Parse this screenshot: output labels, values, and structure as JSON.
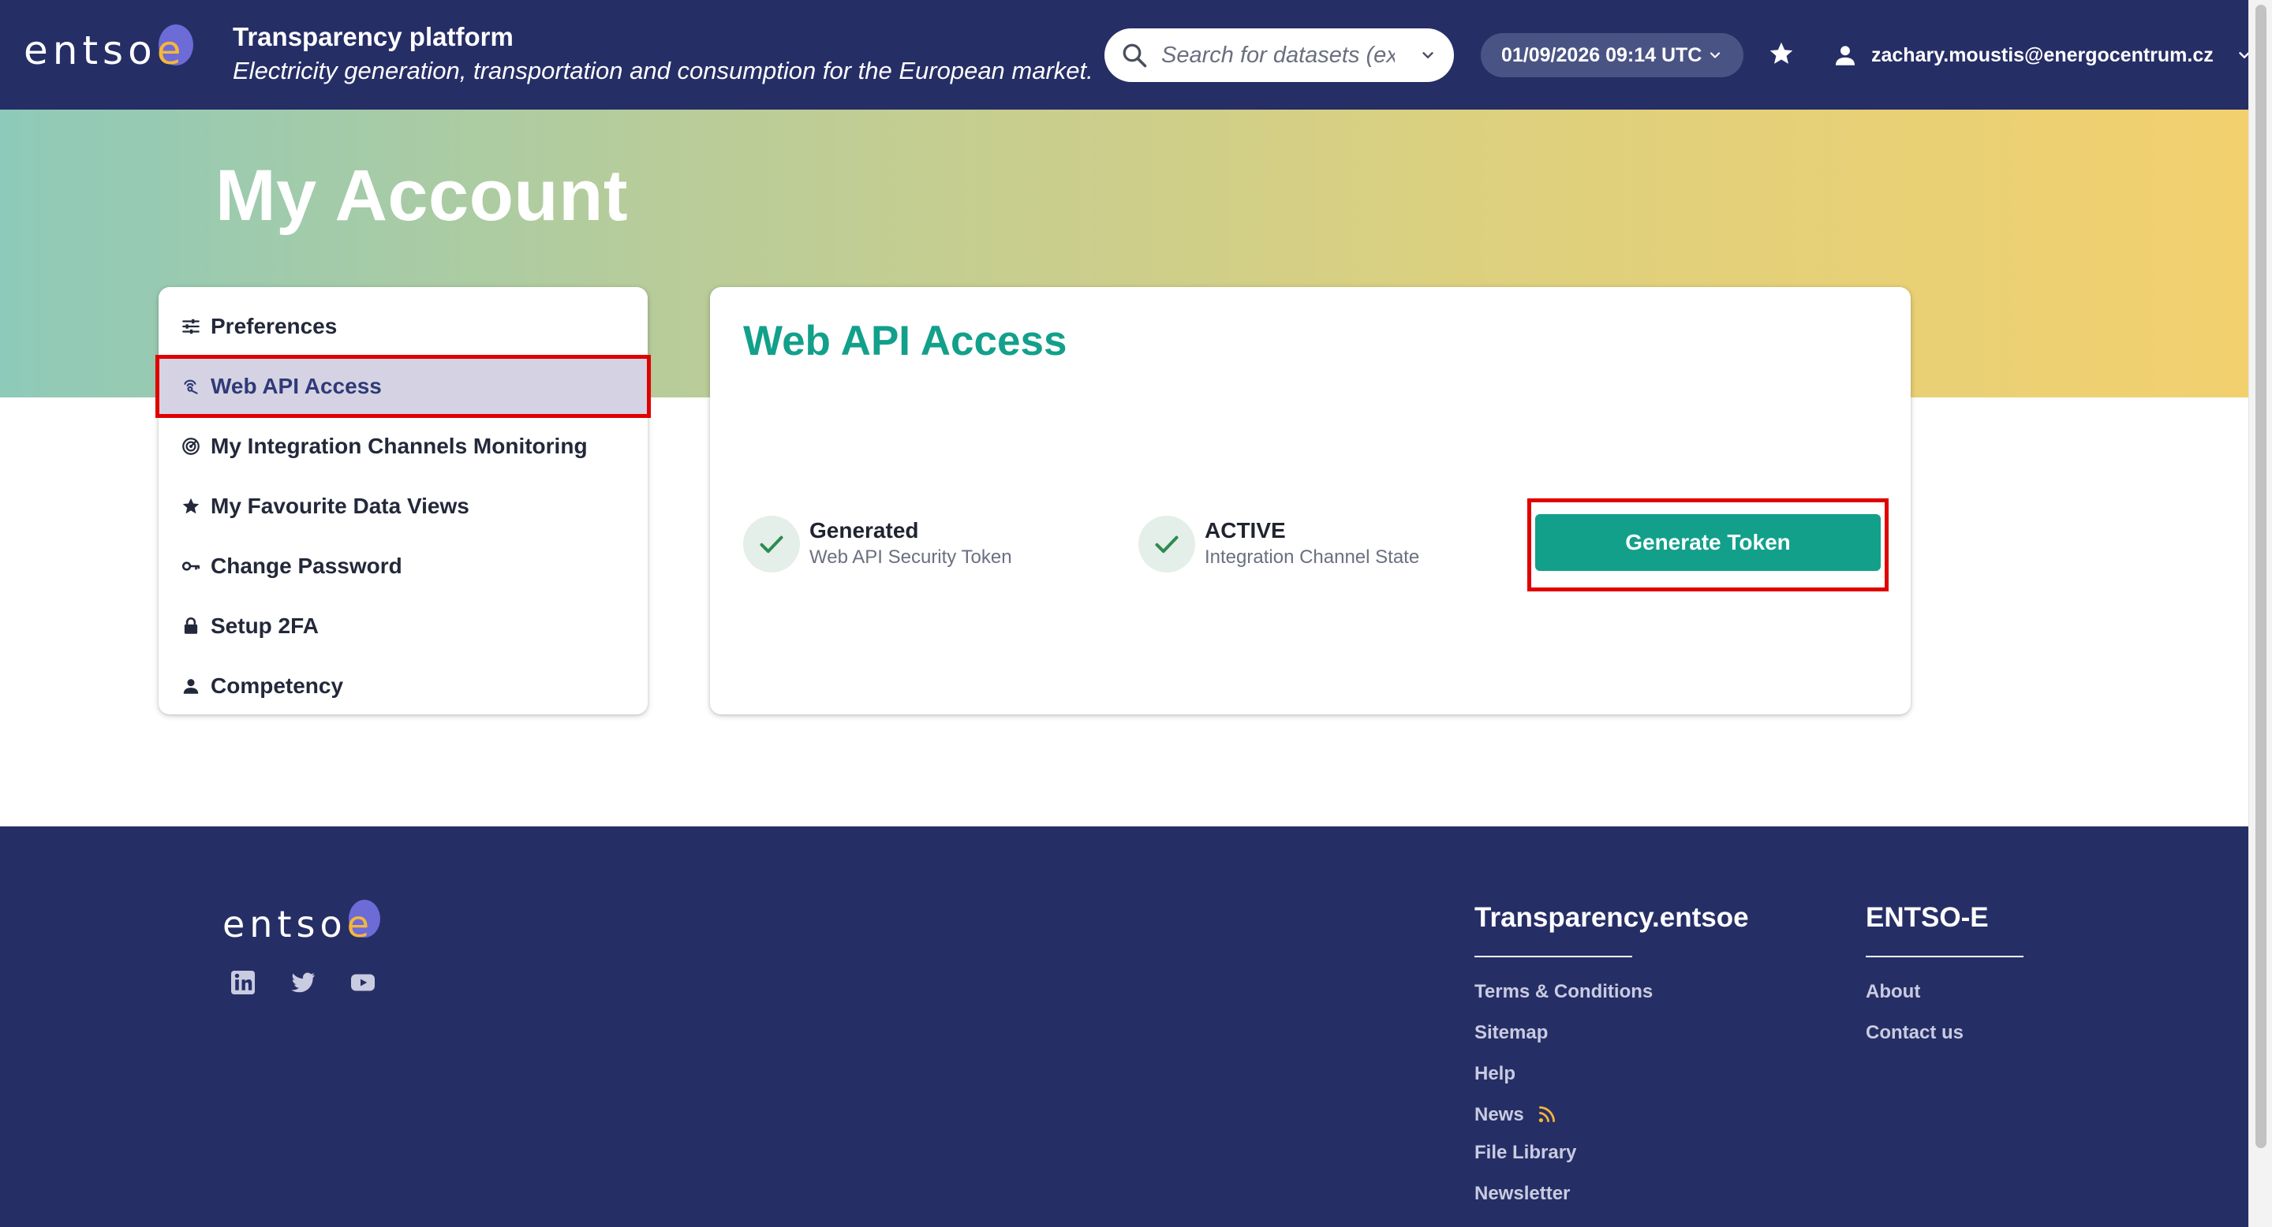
{
  "header": {
    "logo_text": "entso",
    "logo_e": "e",
    "title": "Transparency platform",
    "subtitle": "Electricity generation, transportation and consumption for the European market.",
    "search_placeholder": "Search for datasets (ex:...",
    "datetime": "01/09/2026 09:14 UTC",
    "user_email": "zachary.moustis@energocentrum.cz"
  },
  "page": {
    "title": "My Account"
  },
  "sidebar": {
    "items": [
      {
        "label": "Preferences",
        "icon": "sliders-icon"
      },
      {
        "label": "Web API Access",
        "icon": "api-icon",
        "active": true
      },
      {
        "label": "My Integration Channels Monitoring",
        "icon": "monitoring-icon"
      },
      {
        "label": "My Favourite Data Views",
        "icon": "star-icon"
      },
      {
        "label": "Change Password",
        "icon": "key-icon"
      },
      {
        "label": "Setup 2FA",
        "icon": "lock-icon"
      },
      {
        "label": "Competency",
        "icon": "person-icon"
      }
    ]
  },
  "main": {
    "title": "Web API Access",
    "statuses": [
      {
        "label": "Generated",
        "sub": "Web API Security Token"
      },
      {
        "label": "ACTIVE",
        "sub": "Integration Channel State"
      }
    ],
    "generate_button": "Generate Token"
  },
  "footer": {
    "logo_text": "entso",
    "logo_e": "e",
    "social": [
      "linkedin-icon",
      "twitter-icon",
      "youtube-icon"
    ],
    "columns": [
      {
        "title": "Transparency.entsoe",
        "links": [
          "Terms & Conditions",
          "Sitemap",
          "Help",
          "News",
          "File Library",
          "Newsletter"
        ]
      },
      {
        "title": "ENTSO-E",
        "links": [
          "About",
          "Contact us"
        ]
      }
    ]
  },
  "colors": {
    "navy": "#262e66",
    "teal": "#12a08b",
    "highlight": "#e00000",
    "active_item_bg": "#d5d3e3"
  }
}
